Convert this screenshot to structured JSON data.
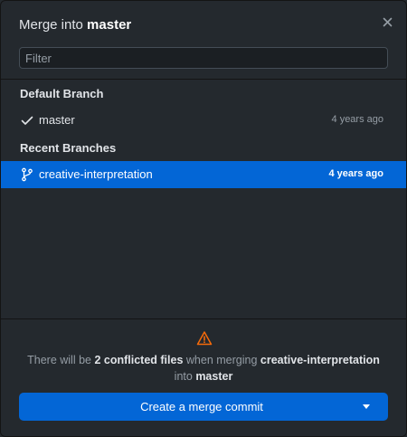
{
  "dialog": {
    "title_prefix": "Merge into",
    "title_branch": "master"
  },
  "filter": {
    "placeholder": "Filter",
    "value": ""
  },
  "groups": {
    "default": {
      "header": "Default Branch",
      "branch": {
        "name": "master",
        "time": "4 years ago",
        "icon": "check-icon"
      }
    },
    "recent": {
      "header": "Recent Branches",
      "branch": {
        "name": "creative-interpretation",
        "time": "4 years ago",
        "icon": "git-branch-icon",
        "selected": true
      }
    }
  },
  "footer": {
    "warning_icon": "alert-icon",
    "message": {
      "part1": "There will be ",
      "conflicts": "2 conflicted files",
      "part2": " when merging ",
      "source": "creative-interpretation",
      "part3": " into ",
      "target": "master"
    },
    "button_label": "Create a merge commit",
    "button_dropdown_icon": "triangle-down-icon"
  },
  "colors": {
    "background": "#24292e",
    "accent": "#0366d6",
    "warning": "#f66a0a"
  }
}
